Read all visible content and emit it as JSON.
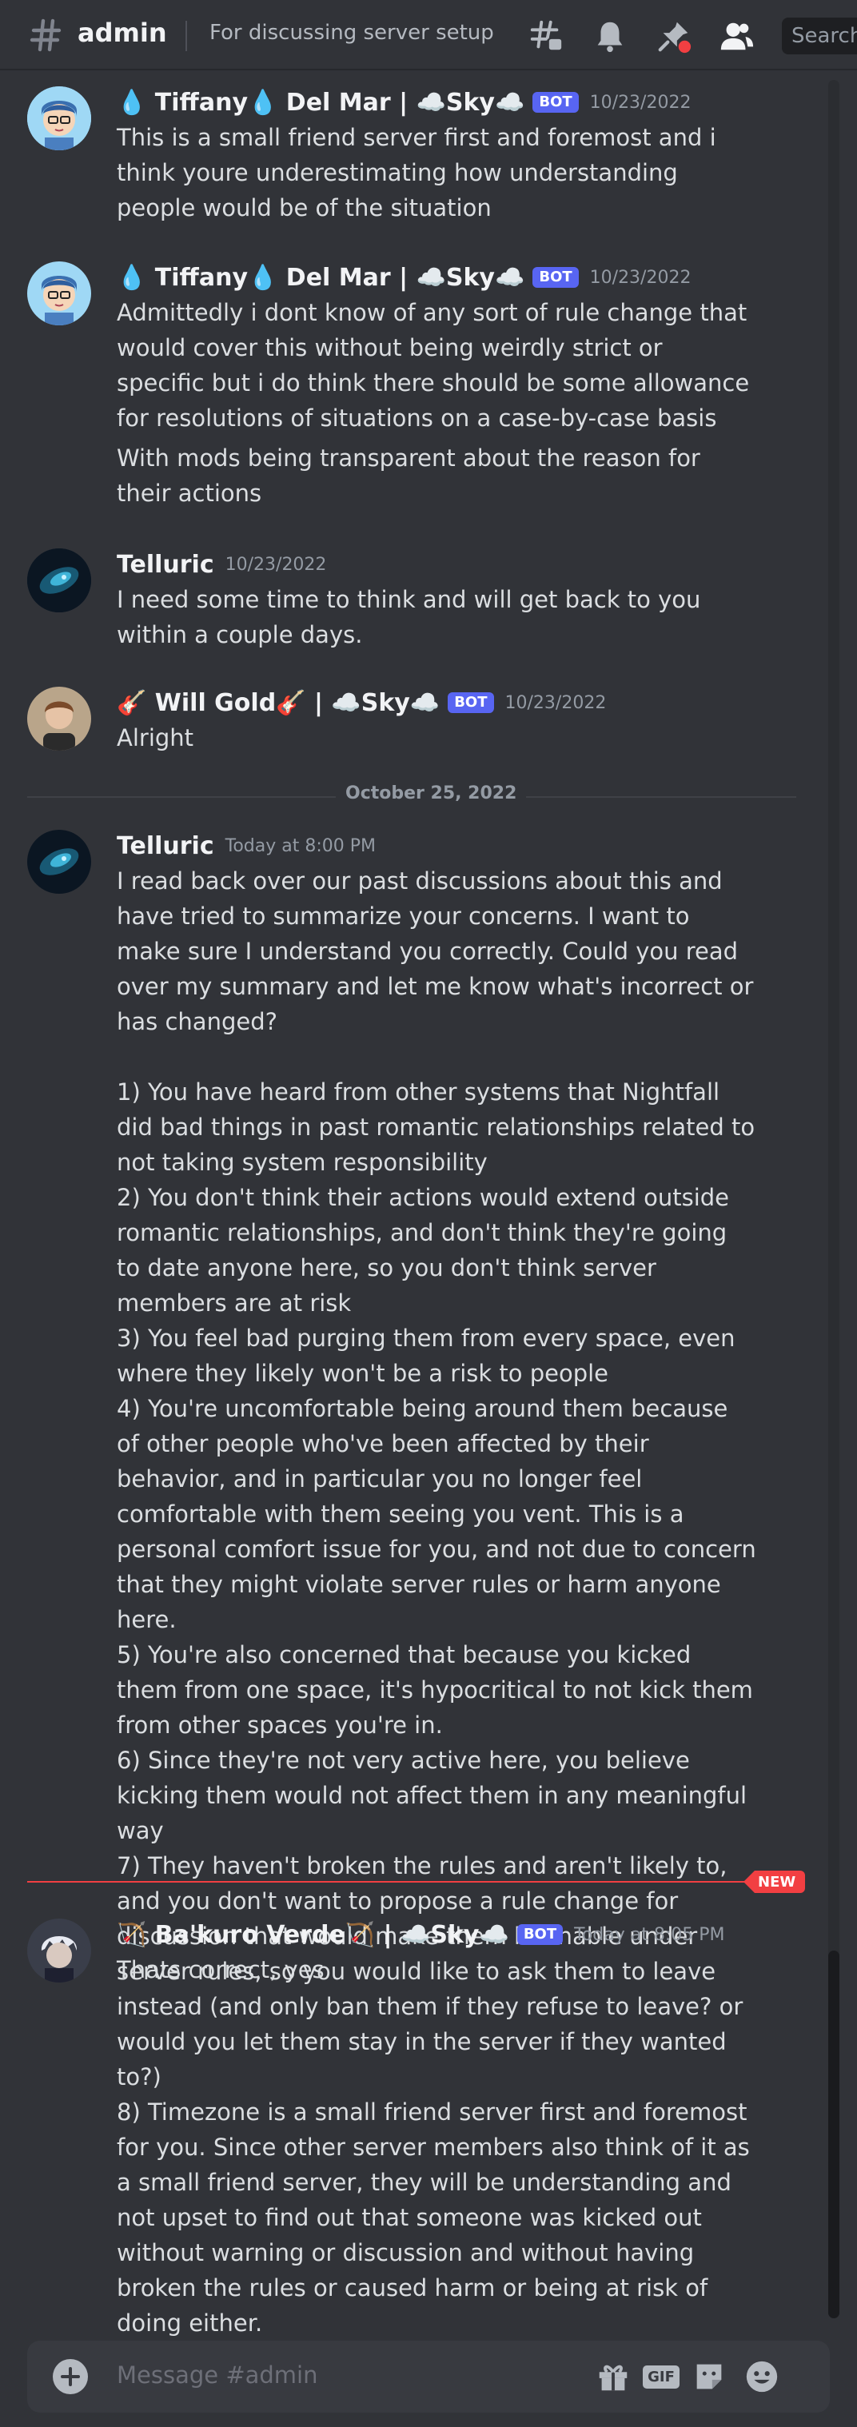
{
  "header": {
    "channel_name": "admin",
    "topic": "For discussing server setup",
    "search_placeholder": "Search"
  },
  "messages": [
    {
      "author": "💧 Tiffany💧  Del Mar | ☁️Sky☁️",
      "bot_tag": "BOT",
      "timestamp": "10/23/2022",
      "text": "This is a small friend server first and foremost and i think youre underestimating how understanding people would be of the situation"
    },
    {
      "author": "💧 Tiffany💧  Del Mar | ☁️Sky☁️",
      "bot_tag": "BOT",
      "timestamp": "10/23/2022",
      "text": "Admittedly i dont know of any sort of rule change that would cover this without being weirdly strict or specific but i do think there should be some allowance for resolutions of situations on a case-by-case basis",
      "text2": "With mods being transparent about the reason for their actions"
    },
    {
      "author": "Telluric",
      "timestamp": "10/23/2022",
      "text": "I need some time to think and will get back to you within a couple days."
    },
    {
      "author": "🎸 Will Gold🎸  | ☁️Sky☁️",
      "bot_tag": "BOT",
      "timestamp": "10/23/2022",
      "text": "Alright"
    },
    {
      "author": "Telluric",
      "timestamp": "Today at 8:00 PM",
      "text": "I read back over our past discussions about this and have tried to summarize your concerns. I want to make sure I understand you correctly. Could you read over my summary and let me know what's incorrect or has changed?\n\n1) You have heard from other systems that Nightfall did bad things in past romantic relationships related to not taking system responsibility\n2) You don't think their actions would extend outside romantic relationships, and don't think they're going to date anyone here, so you don't think server members are at risk\n3) You feel bad purging them from every space, even where they likely won't be a risk to people\n4) You're uncomfortable being around them because of other people who've been affected by their behavior, and in particular you no longer feel comfortable with them seeing you vent. This is a personal comfort issue for you, and not due to concern that they might violate server rules or harm anyone here.\n5) You're also concerned that because you kicked them from one space, it's hypocritical to not kick them from other spaces you're in.\n6) Since they're not very active here, you believe kicking them would not affect them in any meaningful way\n7) They haven't broken the rules and aren't likely to, and you don't want to propose a rule change for discussion that would make them bannable under server rules, so you would like to ask them to leave instead (and only ban them if they refuse to leave? or would you let them stay in the server if they wanted to?)\n8) Timezone is a small friend server first and foremost for you. Since other server members also think of it as a small friend server, they will be understanding and not upset to find out that someone was kicked out without warning or discussion and without having broken the rules or caused harm or being at risk of doing either."
    },
    {
      "author": "🏹 Ba'kuro Verde🏹  | ☁️Sky☁️",
      "bot_tag": "BOT",
      "timestamp": "Today at 8:05 PM",
      "text": "Thats correct, yes"
    }
  ],
  "date_divider": "October 25, 2022",
  "new_badge": "NEW",
  "composer": {
    "placeholder": "Message #admin",
    "gif_label": "GIF"
  },
  "colors": {
    "background": "#313338",
    "bot_badge": "#5865f2",
    "new_divider": "#f23f42"
  },
  "icons": [
    "hash-icon",
    "threads-icon",
    "bell-icon",
    "pin-icon",
    "members-icon",
    "plus-icon",
    "gift-icon",
    "gif-icon",
    "sticker-icon",
    "emoji-icon"
  ]
}
